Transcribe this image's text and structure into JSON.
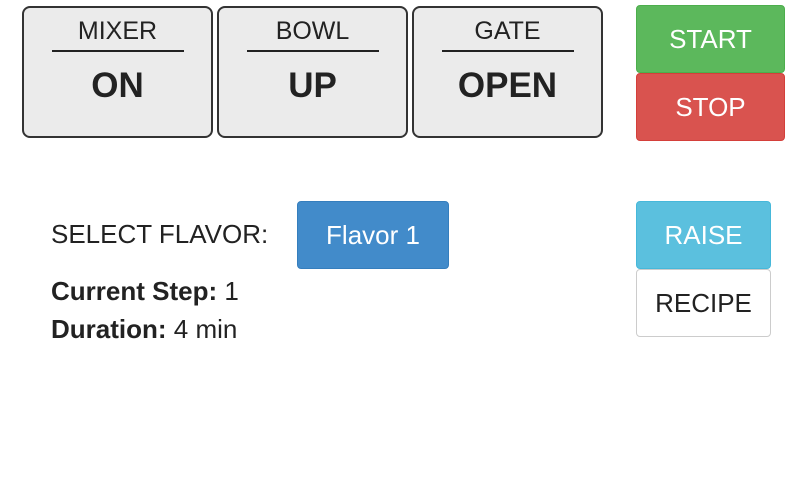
{
  "status": {
    "mixer": {
      "label": "MIXER",
      "value": "ON"
    },
    "bowl": {
      "label": "BOWL",
      "value": "UP"
    },
    "gate": {
      "label": "GATE",
      "value": "OPEN"
    }
  },
  "controls": {
    "start_label": "START",
    "stop_label": "STOP",
    "raise_label": "RAISE",
    "recipe_label": "RECIPE"
  },
  "flavor": {
    "select_label": "SELECT FLAVOR:",
    "selected": "Flavor 1"
  },
  "info": {
    "step_key": "Current Step:",
    "step_value": "1",
    "duration_key": "Duration:",
    "duration_value": "4 min"
  },
  "colors": {
    "start": "#5cb85c",
    "stop": "#d9534f",
    "raise": "#5bc0de",
    "flavor": "#428bca",
    "status_bg": "#ebebeb"
  }
}
